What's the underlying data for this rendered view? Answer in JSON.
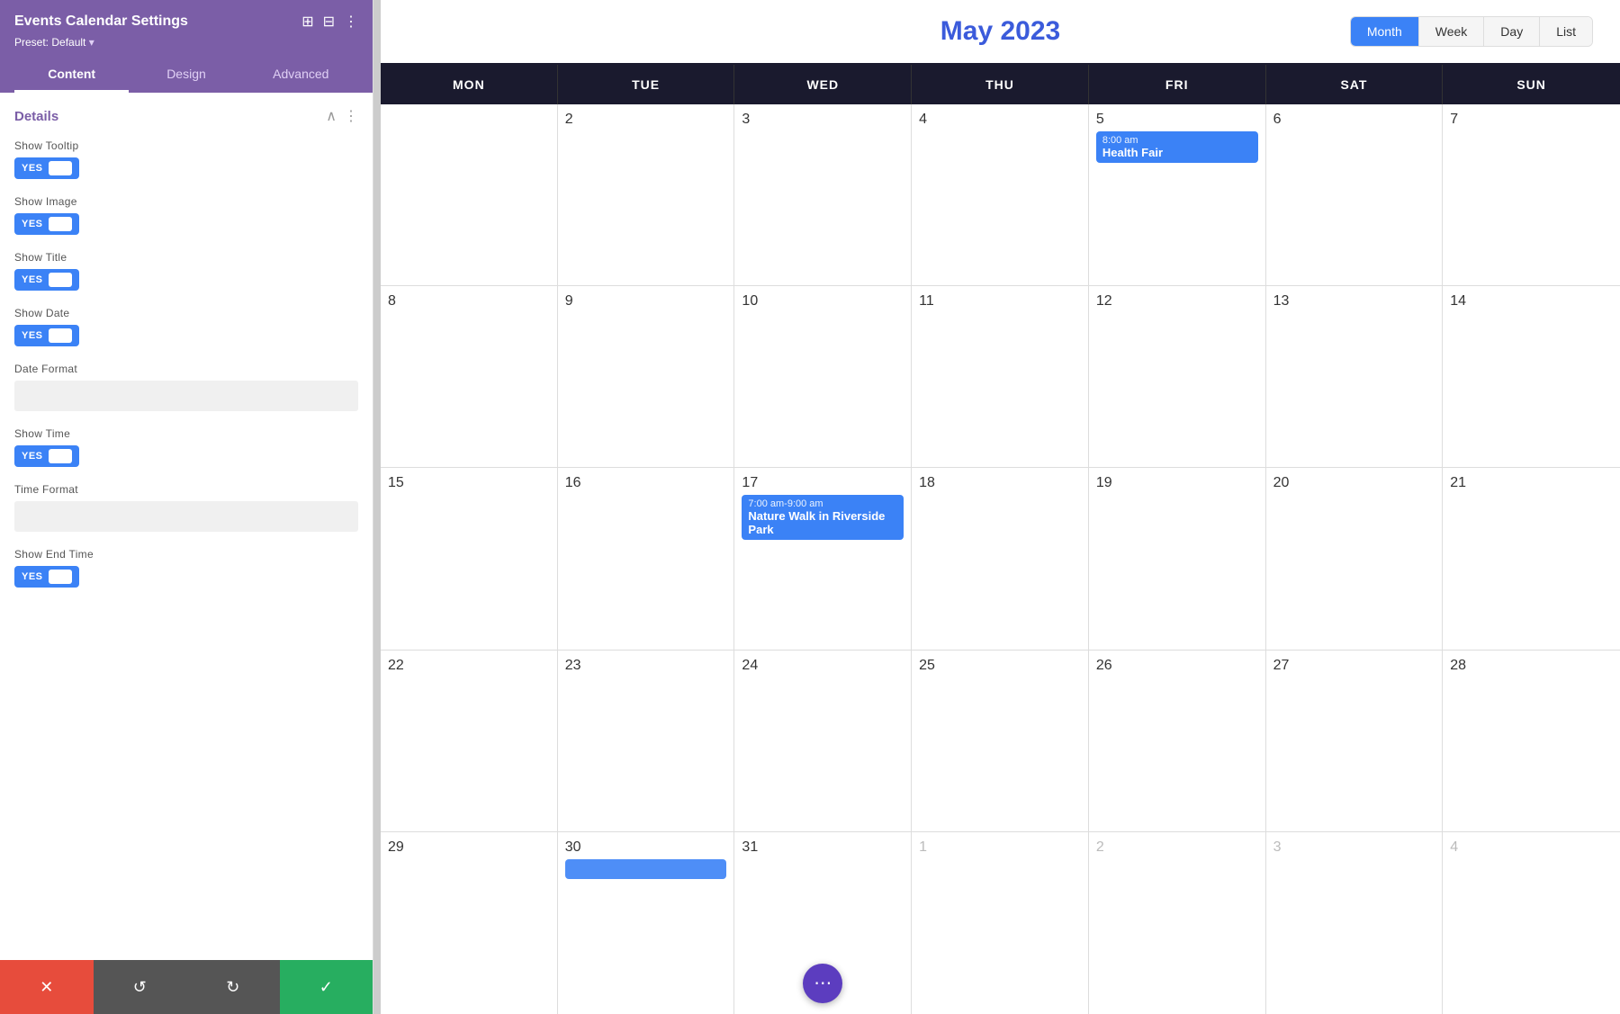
{
  "panel": {
    "title": "Events Calendar Settings",
    "preset": "Preset: Default",
    "tabs": [
      "Content",
      "Design",
      "Advanced"
    ],
    "active_tab": "Content"
  },
  "details": {
    "section_title": "Details",
    "fields": [
      {
        "label": "Show Tooltip",
        "type": "toggle",
        "value": "YES"
      },
      {
        "label": "Show Image",
        "type": "toggle",
        "value": "YES"
      },
      {
        "label": "Show Title",
        "type": "toggle",
        "value": "YES"
      },
      {
        "label": "Show Date",
        "type": "toggle",
        "value": "YES"
      },
      {
        "label": "Date Format",
        "type": "text",
        "value": ""
      },
      {
        "label": "Show Time",
        "type": "toggle",
        "value": "YES"
      },
      {
        "label": "Time Format",
        "type": "text",
        "value": ""
      },
      {
        "label": "Show End Time",
        "type": "toggle",
        "value": "YES"
      }
    ]
  },
  "bottom_bar": {
    "cancel_icon": "✕",
    "undo_icon": "↺",
    "redo_icon": "↻",
    "save_icon": "✓"
  },
  "calendar": {
    "title": "May 2023",
    "view_buttons": [
      "Month",
      "Week",
      "Day",
      "List"
    ],
    "active_view": "Month",
    "day_headers": [
      "MON",
      "TUE",
      "WED",
      "THU",
      "FRI",
      "SAT",
      "SUN"
    ],
    "weeks": [
      [
        {
          "day": "",
          "other": true
        },
        {
          "day": "2",
          "other": false
        },
        {
          "day": "3",
          "other": false
        },
        {
          "day": "4",
          "other": false
        },
        {
          "day": "5",
          "other": false,
          "event": {
            "time": "8:00 am",
            "name": "Health Fair",
            "color": "blue"
          }
        },
        {
          "day": "6",
          "other": false
        },
        {
          "day": "7",
          "other": false
        }
      ],
      [
        {
          "day": "8",
          "other": false,
          "partial": true
        },
        {
          "day": "9",
          "other": false
        },
        {
          "day": "10",
          "other": false
        },
        {
          "day": "11",
          "other": false
        },
        {
          "day": "12",
          "other": false
        },
        {
          "day": "13",
          "other": false
        },
        {
          "day": "14",
          "other": false
        }
      ],
      [
        {
          "day": "15",
          "other": false
        },
        {
          "day": "16",
          "other": false
        },
        {
          "day": "17",
          "other": false,
          "event": {
            "time": "7:00 am-9:00 am",
            "name": "Nature Walk in Riverside Park",
            "color": "blue"
          }
        },
        {
          "day": "18",
          "other": false
        },
        {
          "day": "19",
          "other": false
        },
        {
          "day": "20",
          "other": false
        },
        {
          "day": "21",
          "other": false
        }
      ],
      [
        {
          "day": "22",
          "other": false,
          "partial": true
        },
        {
          "day": "23",
          "other": false
        },
        {
          "day": "24",
          "other": false
        },
        {
          "day": "25",
          "other": false
        },
        {
          "day": "26",
          "other": false
        },
        {
          "day": "27",
          "other": false
        },
        {
          "day": "28",
          "other": false
        }
      ],
      [
        {
          "day": "29",
          "other": false,
          "partial": true
        },
        {
          "day": "30",
          "other": false,
          "event_partial": {
            "color": "blue"
          }
        },
        {
          "day": "31",
          "other": false,
          "fab": true
        },
        {
          "day": "1",
          "other": true
        },
        {
          "day": "2",
          "other": true
        },
        {
          "day": "3",
          "other": true
        },
        {
          "day": "4",
          "other": true
        }
      ]
    ]
  }
}
